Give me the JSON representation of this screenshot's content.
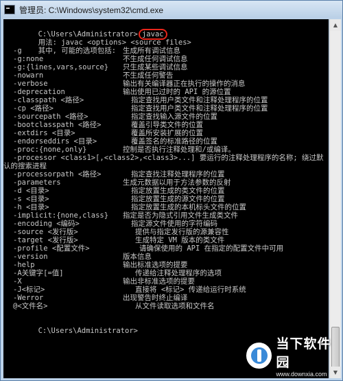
{
  "window": {
    "title": "管理员: C:\\Windows\\system32\\cmd.exe"
  },
  "console": {
    "prompt": "C:\\Users\\Administrator>",
    "command": "javac",
    "usage": "用法: javac <options> <source files>",
    "intro": "其中, 可能的选项包括:",
    "options": [
      {
        "opt": "-g",
        "desc": "生成所有调试信息",
        "col": 1
      },
      {
        "opt": "-g:none",
        "desc": "不生成任何调试信息",
        "col": 1
      },
      {
        "opt": "-g:{lines,vars,source}",
        "desc": "只生成某些调试信息",
        "col": 1
      },
      {
        "opt": "-nowarn",
        "desc": "不生成任何警告",
        "col": 1
      },
      {
        "opt": "-verbose",
        "desc": "输出有关编译器正在执行的操作的消息",
        "col": 1
      },
      {
        "opt": "-deprecation",
        "desc": "输出使用已过时的 API 的源位置",
        "col": 1
      },
      {
        "opt": "-classpath <路径>",
        "desc": "指定查找用户类文件和注释处理程序的位置",
        "col": 2
      },
      {
        "opt": "-cp <路径>",
        "desc": "指定查找用户类文件和注释处理程序的位置",
        "col": 2
      },
      {
        "opt": "-sourcepath <路径>",
        "desc": "指定查找输入源文件的位置",
        "col": 2
      },
      {
        "opt": "-bootclasspath <路径>",
        "desc": "覆盖引导类文件的位置",
        "col": 2
      },
      {
        "opt": "-extdirs <目录>",
        "desc": "覆盖所安装扩展的位置",
        "col": 2
      },
      {
        "opt": "-endorseddirs <目录>",
        "desc": "覆盖签名的标准路径的位置",
        "col": 2
      },
      {
        "opt": "-proc:{none,only}",
        "desc": "控制是否执行注释处理和/或编译。",
        "col": 1
      },
      {
        "opt": "-processor <class1>[,<class2>,<class3>...] 要运行的注释处理程序的名称; 绕过默",
        "desc": "",
        "col": 0
      },
      {
        "opt": "认的搜索进程",
        "desc": "",
        "col": -1
      },
      {
        "opt": "-processorpath <路径>",
        "desc": "指定查找注释处理程序的位置",
        "col": 2
      },
      {
        "opt": "-parameters",
        "desc": "生成元数据以用于方法参数的反射",
        "col": 1
      },
      {
        "opt": "-d <目录>",
        "desc": "指定放置生成的类文件的位置",
        "col": 2
      },
      {
        "opt": "-s <目录>",
        "desc": "指定放置生成的源文件的位置",
        "col": 2
      },
      {
        "opt": "-h <目录>",
        "desc": "指定放置生成的本机标头文件的位置",
        "col": 2
      },
      {
        "opt": "-implicit:{none,class}",
        "desc": "指定是否为隐式引用文件生成类文件",
        "col": 1
      },
      {
        "opt": "-encoding <编码>",
        "desc": "指定源文件使用的字符编码",
        "col": 2
      },
      {
        "opt": "-source <发行版>",
        "desc": "提供与指定发行版的源兼容性",
        "col": 3
      },
      {
        "opt": "-target <发行版>",
        "desc": "生成特定 VM 版本的类文件",
        "col": 3
      },
      {
        "opt": "-profile <配置文件>",
        "desc": "请确保使用的 API 在指定的配置文件中可用",
        "col": 4
      },
      {
        "opt": "-version",
        "desc": "版本信息",
        "col": 1
      },
      {
        "opt": "-help",
        "desc": "输出标准选项的提要",
        "col": 1
      },
      {
        "opt": "-A关键字[=值]",
        "desc": "传递给注释处理程序的选项",
        "col": 3
      },
      {
        "opt": "-X",
        "desc": "输出非标准选项的提要",
        "col": 1
      },
      {
        "opt": "-J<标记>",
        "desc": "直接将 <标记> 传递给运行时系统",
        "col": 3
      },
      {
        "opt": "-Werror",
        "desc": "出现警告时终止编译",
        "col": 1
      },
      {
        "opt": "@<文件名>",
        "desc": "从文件读取选项和文件名",
        "col": 3
      }
    ],
    "final_prompt": "C:\\Users\\Administrator>"
  },
  "watermark": {
    "name": "当下软件园",
    "url": "www.downxia.com"
  },
  "colors": {
    "console_bg": "#000000",
    "console_text": "#c8c8c8",
    "highlight": "#e8261b"
  }
}
